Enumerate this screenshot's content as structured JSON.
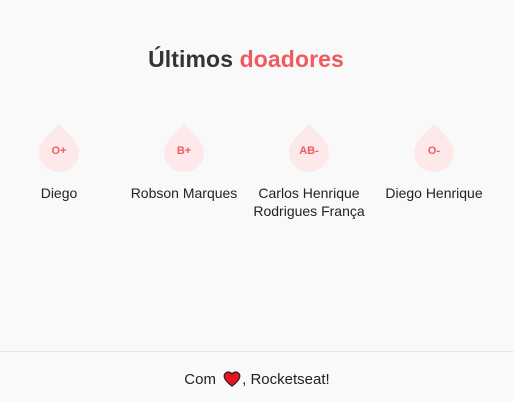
{
  "header": {
    "title_main": "Últimos",
    "title_accent": "doadores"
  },
  "donors": [
    {
      "blood_type": "O+",
      "name": "Diego"
    },
    {
      "blood_type": "B+",
      "name": "Robson Marques"
    },
    {
      "blood_type": "AB-",
      "name": "Carlos Henrique Rodrigues França"
    },
    {
      "blood_type": "O-",
      "name": "Diego Henrique"
    }
  ],
  "footer": {
    "prefix": "Com",
    "heart_icon": "heart-icon",
    "suffix": ", Rocketseat!"
  },
  "colors": {
    "accent": "#f05a5e",
    "drop_fill": "#fde9ea",
    "heart": "#e8141e"
  }
}
